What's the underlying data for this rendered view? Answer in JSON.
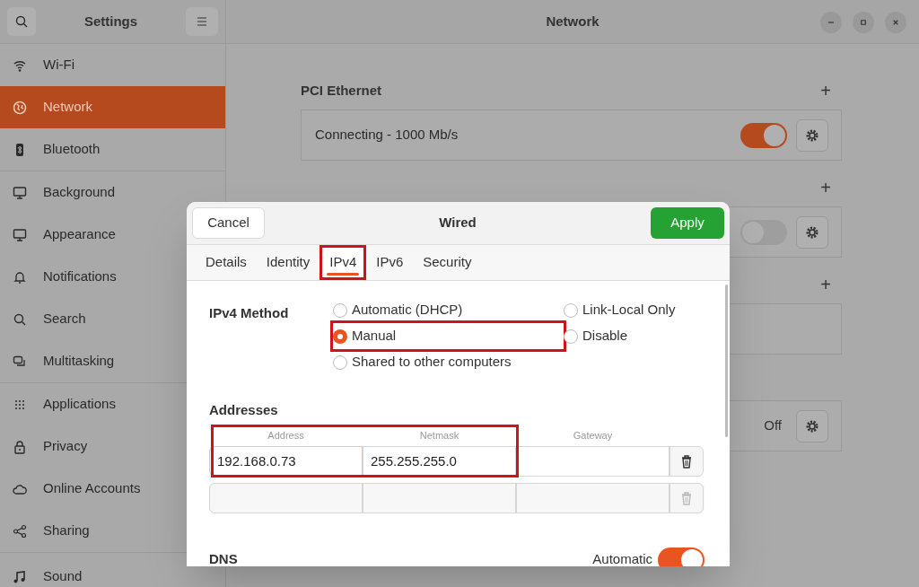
{
  "sidebar": {
    "title": "Settings",
    "groups": [
      [
        {
          "label": "Wi-Fi",
          "selected": false
        },
        {
          "label": "Network",
          "selected": true
        },
        {
          "label": "Bluetooth",
          "selected": false
        }
      ],
      [
        {
          "label": "Background",
          "selected": false
        },
        {
          "label": "Appearance",
          "selected": false
        },
        {
          "label": "Notifications",
          "selected": false
        },
        {
          "label": "Search",
          "selected": false
        },
        {
          "label": "Multitasking",
          "selected": false
        }
      ],
      [
        {
          "label": "Applications",
          "selected": false
        },
        {
          "label": "Privacy",
          "selected": false
        },
        {
          "label": "Online Accounts",
          "selected": false
        },
        {
          "label": "Sharing",
          "selected": false
        }
      ],
      [
        {
          "label": "Sound",
          "selected": false
        }
      ]
    ]
  },
  "window": {
    "title": "Network"
  },
  "sections": [
    {
      "title": "PCI Ethernet",
      "add": "+",
      "card": {
        "kind": "toggle",
        "text": "Connecting - 1000 Mb/s",
        "on": true
      }
    },
    {
      "add": "+",
      "card": {
        "kind": "toggle",
        "on": false
      }
    },
    {
      "add": "+",
      "card": {
        "kind": "blank"
      }
    },
    {
      "card": {
        "kind": "status",
        "status": "Off"
      }
    }
  ],
  "dialog": {
    "title": "Wired",
    "cancel": "Cancel",
    "apply": "Apply",
    "tabs": [
      {
        "label": "Details",
        "selected": false,
        "highlighted": false
      },
      {
        "label": "Identity",
        "selected": false,
        "highlighted": false
      },
      {
        "label": "IPv4",
        "selected": true,
        "highlighted": true
      },
      {
        "label": "IPv6",
        "selected": false,
        "highlighted": false
      },
      {
        "label": "Security",
        "selected": false,
        "highlighted": false
      }
    ],
    "method_label": "IPv4 Method",
    "methods": [
      {
        "label": "Automatic (DHCP)",
        "selected": false,
        "highlighted": false
      },
      {
        "label": "Manual",
        "selected": true,
        "highlighted": true
      },
      {
        "label": "Shared to other computers",
        "selected": false,
        "highlighted": false
      },
      {
        "label": "Link-Local Only",
        "selected": false,
        "highlighted": false
      },
      {
        "label": "Disable",
        "selected": false,
        "highlighted": false
      }
    ],
    "addresses_label": "Addresses",
    "columns": [
      "Address",
      "Netmask",
      "Gateway"
    ],
    "rows": [
      {
        "address": "192.168.0.73",
        "netmask": "255.255.255.0",
        "highlighted": true,
        "disabled": false
      },
      {
        "highlighted": false,
        "disabled": true
      }
    ],
    "dns_label": "DNS",
    "dns_auto_label": "Automatic",
    "dns_auto": true
  }
}
